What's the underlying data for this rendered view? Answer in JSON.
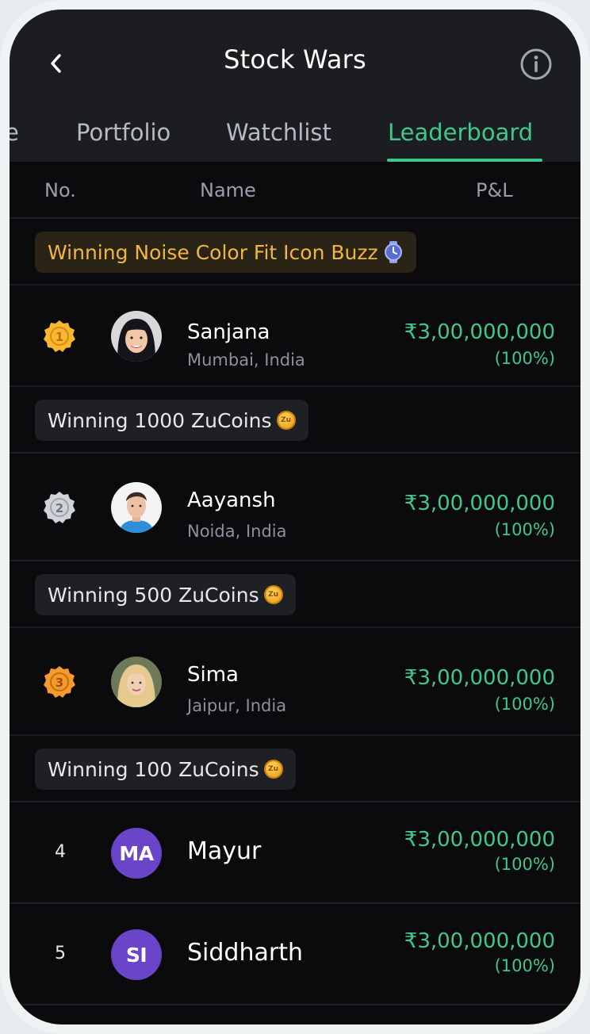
{
  "header": {
    "title": "Stock Wars",
    "back_icon": "chevron-left-icon",
    "info_icon": "info-circle-icon"
  },
  "tabs": [
    {
      "label": "e",
      "active": false
    },
    {
      "label": "Portfolio",
      "active": false
    },
    {
      "label": "Watchlist",
      "active": false
    },
    {
      "label": "Leaderboard",
      "active": true
    }
  ],
  "columns": {
    "no": "No.",
    "name": "Name",
    "pl": "P&L"
  },
  "prizes": [
    {
      "label": "Winning Noise Color Fit Icon Buzz",
      "icon": "watch-icon"
    },
    {
      "label": "Winning 1000 ZuCoins",
      "icon": "zucoin-icon"
    },
    {
      "label": "Winning 500 ZuCoins",
      "icon": "zucoin-icon"
    },
    {
      "label": "Winning 100 ZuCoins",
      "icon": "zucoin-icon"
    }
  ],
  "coin_text": "Zu",
  "leaders": [
    {
      "rank": "1",
      "name": "Sanjana",
      "location": "Mumbai, India",
      "pl": "₹3,00,000,000",
      "pct": "(100%)",
      "badge": "gold"
    },
    {
      "rank": "2",
      "name": "Aayansh",
      "location": "Noida, India",
      "pl": "₹3,00,000,000",
      "pct": "(100%)",
      "badge": "silver"
    },
    {
      "rank": "3",
      "name": "Sima",
      "location": "Jaipur, India",
      "pl": "₹3,00,000,000",
      "pct": "(100%)",
      "badge": "bronze"
    },
    {
      "rank": "4",
      "name": "Mayur",
      "initials": "MA",
      "pl": "₹3,00,000,000",
      "pct": "(100%)"
    },
    {
      "rank": "5",
      "name": "Siddharth",
      "initials": "SI",
      "pl": "₹3,00,000,000",
      "pct": "(100%)"
    }
  ],
  "colors": {
    "accent_green": "#3fc88a",
    "gold_text": "#f2b544",
    "badge_gold": "#f7b731",
    "badge_silver": "#d0d3d8",
    "badge_bronze": "#f59a2e",
    "initials_avatar": "#6a45c9"
  }
}
